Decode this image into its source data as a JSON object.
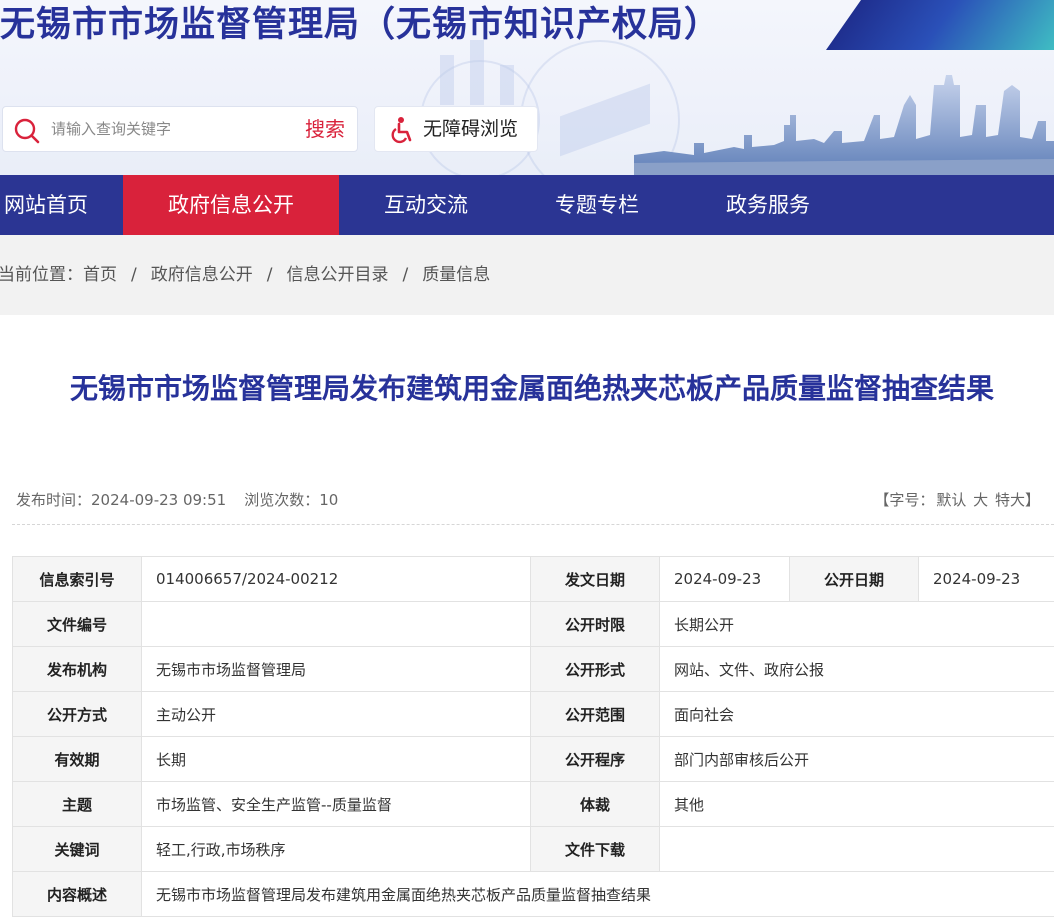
{
  "header": {
    "site_title": "无锡市市场监督管理局（无锡市知识产权局）",
    "search": {
      "placeholder": "请输入查询关键字",
      "button_label": "搜索"
    },
    "accessibility_label": "无障碍浏览"
  },
  "nav": {
    "items": [
      {
        "label": "网站首页"
      },
      {
        "label": "政府信息公开"
      },
      {
        "label": "互动交流"
      },
      {
        "label": "专题专栏"
      },
      {
        "label": "政务服务"
      }
    ],
    "active_index": 1
  },
  "breadcrumb": {
    "prefix": "当前位置：",
    "items": [
      "首页",
      "政府信息公开",
      "信息公开目录",
      "质量信息"
    ],
    "separator": "/"
  },
  "article": {
    "title": "无锡市市场监督管理局发布建筑用金属面绝热夹芯板产品质量监督抽查结果",
    "publish_label": "发布时间：",
    "publish_time": "2024-09-23 09:51",
    "views_label": "浏览次数：",
    "views": "10",
    "font_size": {
      "open": "【字号：",
      "default": "默认",
      "large": "大",
      "xlarge": "特大",
      "close": "】"
    }
  },
  "info_table": {
    "index_no_label": "信息索引号",
    "index_no": "014006657/2024-00212",
    "issue_date_label": "发文日期",
    "issue_date": "2024-09-23",
    "open_date_label": "公开日期",
    "open_date": "2024-09-23",
    "doc_no_label": "文件编号",
    "doc_no": "",
    "open_limit_label": "公开时限",
    "open_limit": "长期公开",
    "publisher_label": "发布机构",
    "publisher": "无锡市市场监督管理局",
    "open_form_label": "公开形式",
    "open_form": "网站、文件、政府公报",
    "open_method_label": "公开方式",
    "open_method": "主动公开",
    "open_scope_label": "公开范围",
    "open_scope": "面向社会",
    "validity_label": "有效期",
    "validity": "长期",
    "open_procedure_label": "公开程序",
    "open_procedure": "部门内部审核后公开",
    "subject_label": "主题",
    "subject": "市场监管、安全生产监管--质量监督",
    "genre_label": "体裁",
    "genre": "其他",
    "keywords_label": "关键词",
    "keywords": "轻工,行政,市场秩序",
    "download_label": "文件下载",
    "download": "",
    "summary_label": "内容概述",
    "summary": "无锡市市场监督管理局发布建筑用金属面绝热夹芯板产品质量监督抽查结果"
  },
  "colors": {
    "brand_blue": "#27329a",
    "nav_blue": "#2b3593",
    "active_red": "#d9223b",
    "search_red": "#d9223b"
  }
}
